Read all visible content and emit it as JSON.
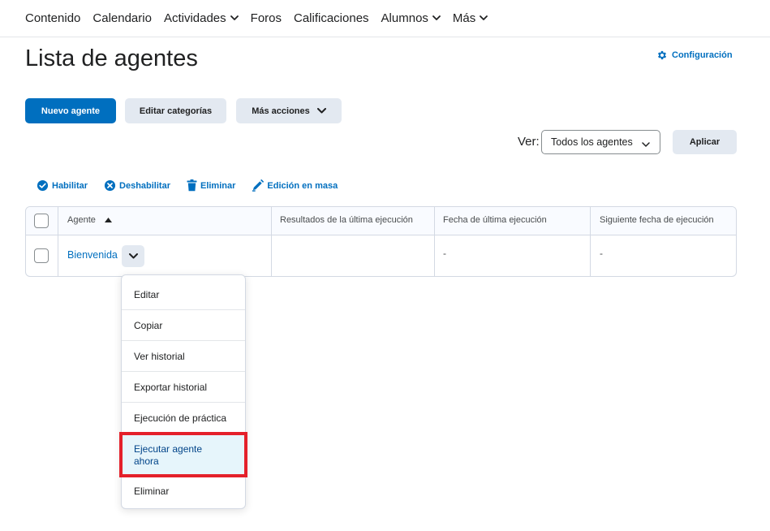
{
  "nav": {
    "items": [
      {
        "label": "Contenido",
        "dropdown": false
      },
      {
        "label": "Calendario",
        "dropdown": false
      },
      {
        "label": "Actividades",
        "dropdown": true
      },
      {
        "label": "Foros",
        "dropdown": false
      },
      {
        "label": "Calificaciones",
        "dropdown": false
      },
      {
        "label": "Alumnos",
        "dropdown": true
      },
      {
        "label": "Más",
        "dropdown": true
      }
    ]
  },
  "page": {
    "title": "Lista de agentes",
    "settings_label": "Configuración"
  },
  "toolbar": {
    "new_agent": "Nuevo agente",
    "edit_categories": "Editar categorías",
    "more_actions": "Más acciones"
  },
  "filter": {
    "label": "Ver:",
    "selected": "Todos los agentes",
    "apply": "Aplicar"
  },
  "bulk_actions": {
    "enable": "Habilitar",
    "disable": "Deshabilitar",
    "delete": "Eliminar",
    "bulk_edit": "Edición en masa"
  },
  "table": {
    "columns": [
      "Agente",
      "Resultados de la última ejecución",
      "Fecha de última ejecución",
      "Siguiente fecha de ejecución"
    ],
    "rows": [
      {
        "agent": "Bienvenida",
        "last_result": "",
        "last_date": "-",
        "next_date": "-"
      }
    ]
  },
  "context_menu": {
    "items": [
      "Editar",
      "Copiar",
      "Ver historial",
      "Exportar historial",
      "Ejecución de práctica",
      "Ejecutar agente ahora",
      "Eliminar"
    ],
    "highlighted_index": 5
  },
  "colors": {
    "primary": "#006fbf",
    "secondary_button": "#e3e9f1",
    "highlight_border": "#e4202a",
    "highlight_bg": "#e6f5fb"
  }
}
